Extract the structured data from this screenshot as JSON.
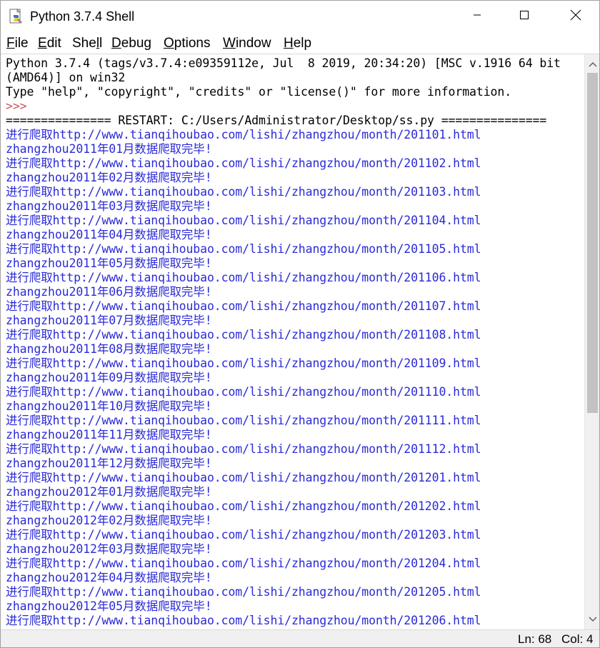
{
  "window": {
    "title": "Python 3.7.4 Shell"
  },
  "menu": {
    "items": [
      {
        "pre": "",
        "u": "F",
        "post": "ile"
      },
      {
        "pre": "",
        "u": "E",
        "post": "dit"
      },
      {
        "pre": "She",
        "u": "l",
        "post": "l"
      },
      {
        "pre": "",
        "u": "D",
        "post": "ebug"
      },
      {
        "pre": "",
        "u": "O",
        "post": "ptions"
      },
      {
        "pre": "",
        "u": "W",
        "post": "indow"
      },
      {
        "pre": "",
        "u": "H",
        "post": "elp"
      }
    ]
  },
  "shell": {
    "lines": [
      {
        "text": "Python 3.7.4 (tags/v3.7.4:e09359112e, Jul  8 2019, 20:34:20) [MSC v.1916 64 bit",
        "style": "black"
      },
      {
        "text": "(AMD64)] on win32",
        "style": "black"
      },
      {
        "text": "Type \"help\", \"copyright\", \"credits\" or \"license()\" for more information.",
        "style": "black"
      },
      {
        "text": ">>> ",
        "style": "prompt"
      },
      {
        "text": "=============== RESTART: C:/Users/Administrator/Desktop/ss.py ===============",
        "style": "black"
      },
      {
        "text": "进行爬取http://www.tianqihoubao.com/lishi/zhangzhou/month/201101.html",
        "style": "blue"
      },
      {
        "text": "zhangzhou2011年01月数据爬取完毕!",
        "style": "blue"
      },
      {
        "text": "进行爬取http://www.tianqihoubao.com/lishi/zhangzhou/month/201102.html",
        "style": "blue"
      },
      {
        "text": "zhangzhou2011年02月数据爬取完毕!",
        "style": "blue"
      },
      {
        "text": "进行爬取http://www.tianqihoubao.com/lishi/zhangzhou/month/201103.html",
        "style": "blue"
      },
      {
        "text": "zhangzhou2011年03月数据爬取完毕!",
        "style": "blue"
      },
      {
        "text": "进行爬取http://www.tianqihoubao.com/lishi/zhangzhou/month/201104.html",
        "style": "blue"
      },
      {
        "text": "zhangzhou2011年04月数据爬取完毕!",
        "style": "blue"
      },
      {
        "text": "进行爬取http://www.tianqihoubao.com/lishi/zhangzhou/month/201105.html",
        "style": "blue"
      },
      {
        "text": "zhangzhou2011年05月数据爬取完毕!",
        "style": "blue"
      },
      {
        "text": "进行爬取http://www.tianqihoubao.com/lishi/zhangzhou/month/201106.html",
        "style": "blue"
      },
      {
        "text": "zhangzhou2011年06月数据爬取完毕!",
        "style": "blue"
      },
      {
        "text": "进行爬取http://www.tianqihoubao.com/lishi/zhangzhou/month/201107.html",
        "style": "blue"
      },
      {
        "text": "zhangzhou2011年07月数据爬取完毕!",
        "style": "blue"
      },
      {
        "text": "进行爬取http://www.tianqihoubao.com/lishi/zhangzhou/month/201108.html",
        "style": "blue"
      },
      {
        "text": "zhangzhou2011年08月数据爬取完毕!",
        "style": "blue"
      },
      {
        "text": "进行爬取http://www.tianqihoubao.com/lishi/zhangzhou/month/201109.html",
        "style": "blue"
      },
      {
        "text": "zhangzhou2011年09月数据爬取完毕!",
        "style": "blue"
      },
      {
        "text": "进行爬取http://www.tianqihoubao.com/lishi/zhangzhou/month/201110.html",
        "style": "blue"
      },
      {
        "text": "zhangzhou2011年10月数据爬取完毕!",
        "style": "blue"
      },
      {
        "text": "进行爬取http://www.tianqihoubao.com/lishi/zhangzhou/month/201111.html",
        "style": "blue"
      },
      {
        "text": "zhangzhou2011年11月数据爬取完毕!",
        "style": "blue"
      },
      {
        "text": "进行爬取http://www.tianqihoubao.com/lishi/zhangzhou/month/201112.html",
        "style": "blue"
      },
      {
        "text": "zhangzhou2011年12月数据爬取完毕!",
        "style": "blue"
      },
      {
        "text": "进行爬取http://www.tianqihoubao.com/lishi/zhangzhou/month/201201.html",
        "style": "blue"
      },
      {
        "text": "zhangzhou2012年01月数据爬取完毕!",
        "style": "blue"
      },
      {
        "text": "进行爬取http://www.tianqihoubao.com/lishi/zhangzhou/month/201202.html",
        "style": "blue"
      },
      {
        "text": "zhangzhou2012年02月数据爬取完毕!",
        "style": "blue"
      },
      {
        "text": "进行爬取http://www.tianqihoubao.com/lishi/zhangzhou/month/201203.html",
        "style": "blue"
      },
      {
        "text": "zhangzhou2012年03月数据爬取完毕!",
        "style": "blue"
      },
      {
        "text": "进行爬取http://www.tianqihoubao.com/lishi/zhangzhou/month/201204.html",
        "style": "blue"
      },
      {
        "text": "zhangzhou2012年04月数据爬取完毕!",
        "style": "blue"
      },
      {
        "text": "进行爬取http://www.tianqihoubao.com/lishi/zhangzhou/month/201205.html",
        "style": "blue"
      },
      {
        "text": "zhangzhou2012年05月数据爬取完毕!",
        "style": "blue"
      },
      {
        "text": "进行爬取http://www.tianqihoubao.com/lishi/zhangzhou/month/201206.html",
        "style": "blue"
      }
    ]
  },
  "status": {
    "line": "Ln: 68",
    "col": "Col: 4"
  },
  "colors": {
    "output_blue": "#2a2ad8",
    "prompt_red": "#c8555a",
    "text_black": "#000000"
  },
  "icons": {
    "app": "python-idle-icon",
    "minimize": "minimize-icon",
    "maximize": "maximize-icon",
    "close": "close-icon",
    "scroll_up": "chevron-up-icon",
    "scroll_down": "chevron-down-icon"
  }
}
